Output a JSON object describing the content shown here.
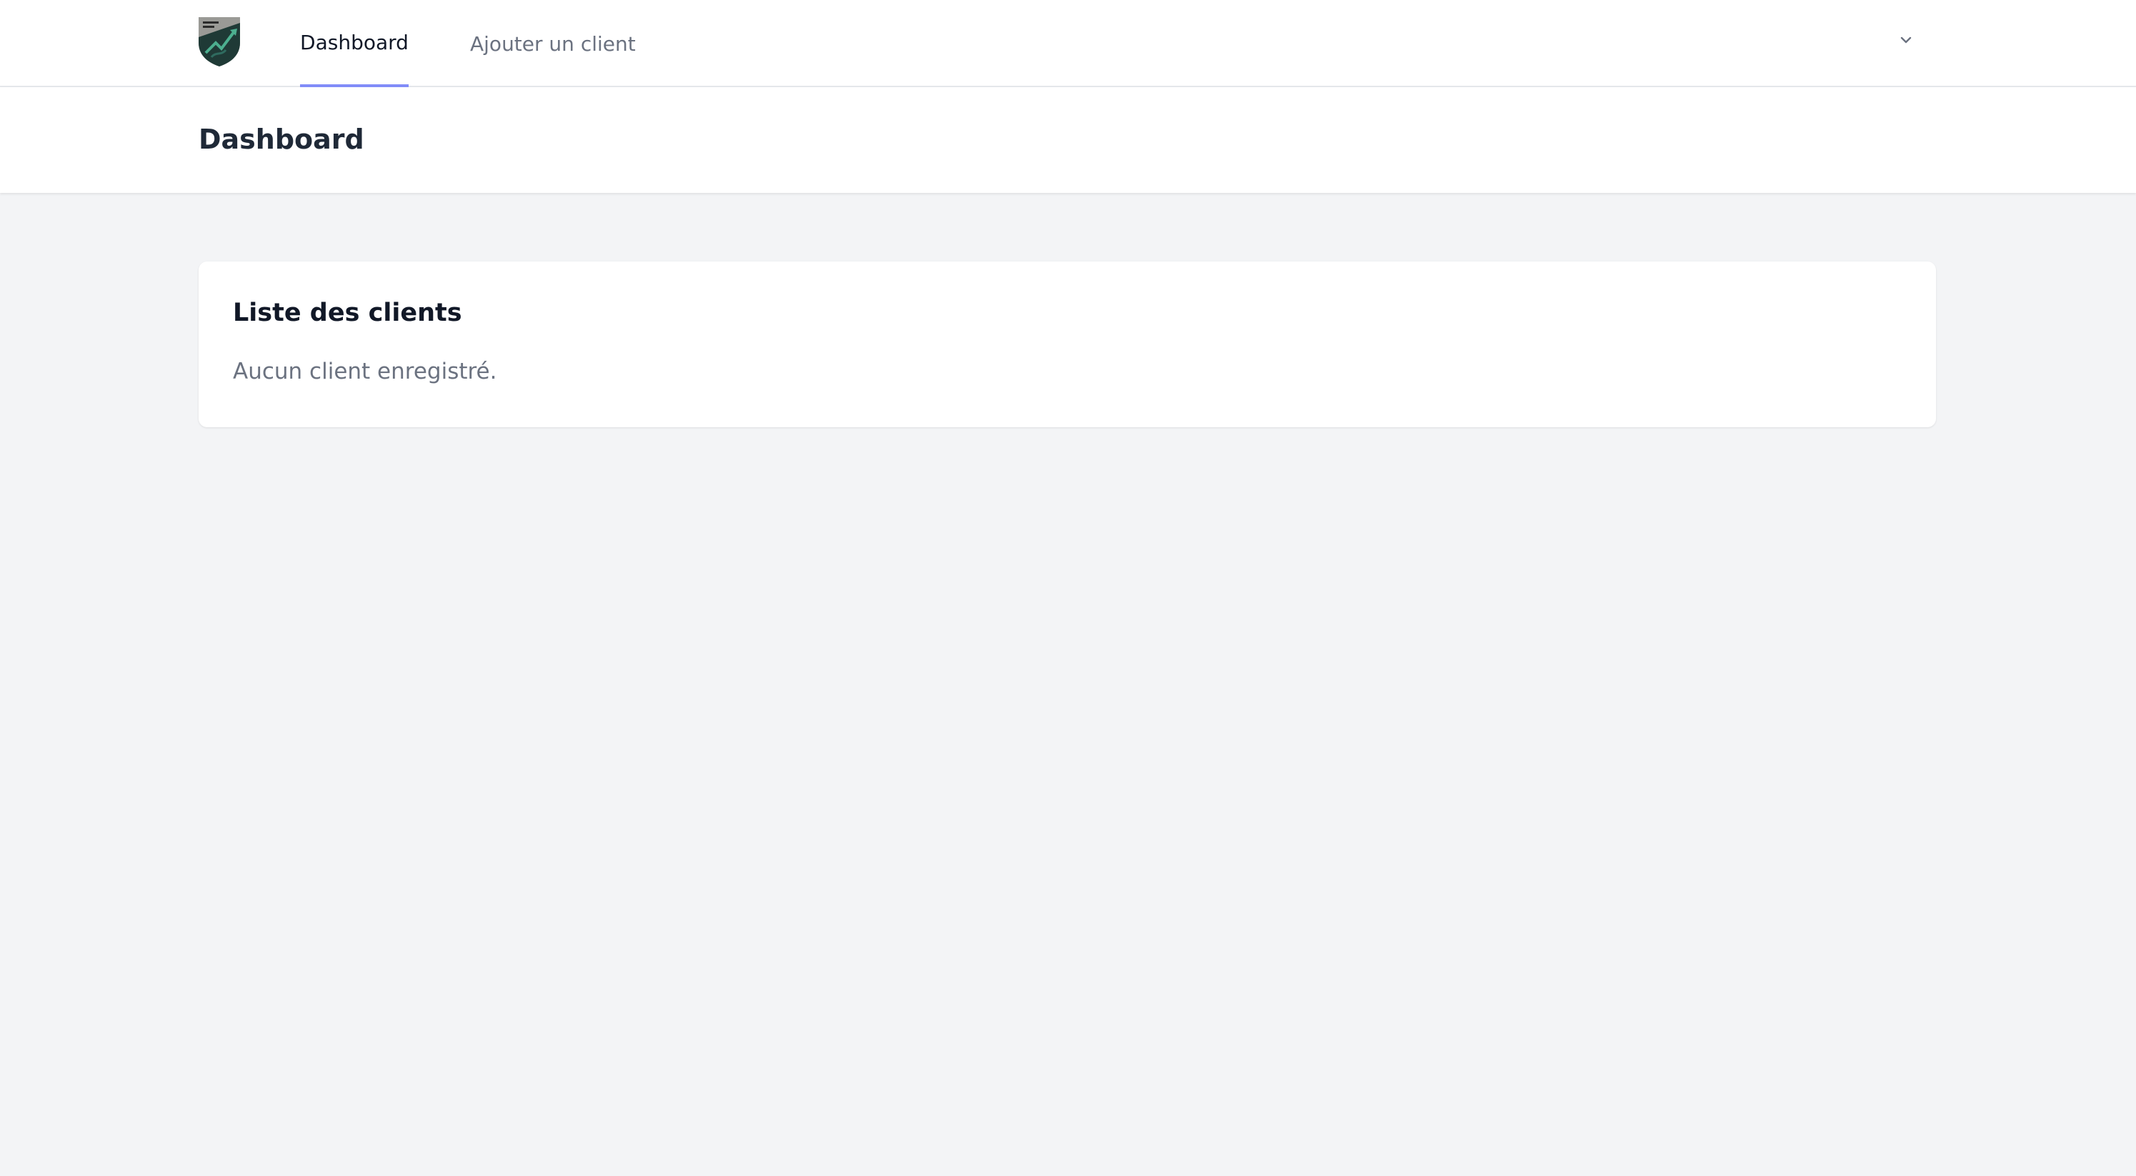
{
  "nav": {
    "links": [
      {
        "label": "Dashboard",
        "active": true
      },
      {
        "label": "Ajouter un client",
        "active": false
      }
    ],
    "user_menu_icon": "chevron-down-icon"
  },
  "header": {
    "title": "Dashboard"
  },
  "clients_card": {
    "title": "Liste des clients",
    "empty_message": "Aucun client enregistré."
  },
  "colors": {
    "active_tab_underline": "#818cf8",
    "page_background": "#f3f4f6",
    "card_background": "#ffffff"
  }
}
